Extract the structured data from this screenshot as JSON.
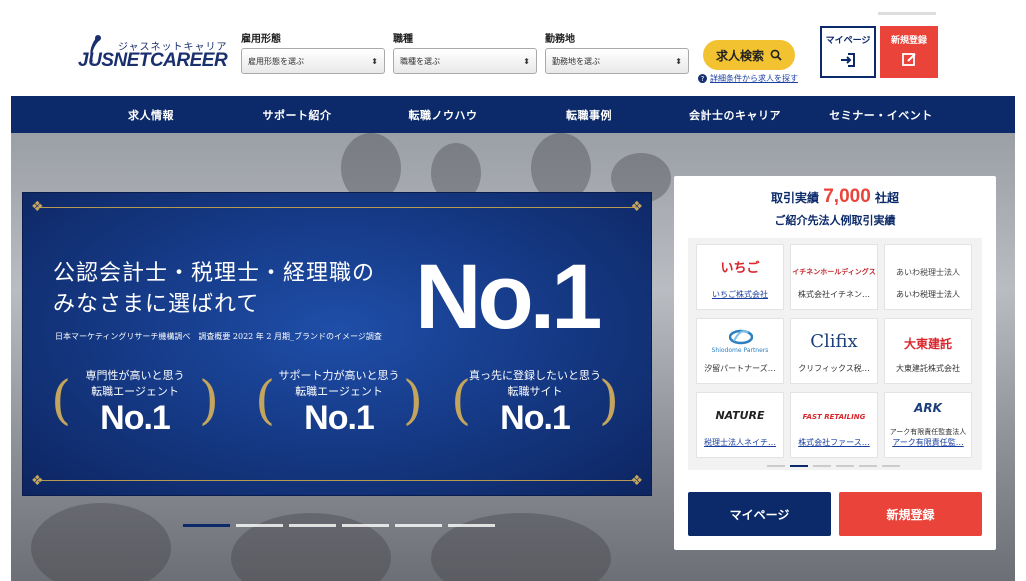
{
  "header": {
    "logo_kana": "ジャスネットキャリア",
    "logo_word": "JUSNETCAREER",
    "selects": [
      {
        "label": "雇用形態",
        "value": "雇用形態を選ぶ"
      },
      {
        "label": "職種",
        "value": "職種を選ぶ"
      },
      {
        "label": "勤務地",
        "value": "勤務地を選ぶ"
      }
    ],
    "search_label": "求人検索",
    "detail_link": "詳細条件から求人を探す",
    "mypage_label": "マイページ",
    "register_label": "新規登録"
  },
  "nav": {
    "items": [
      "求人情報",
      "サポート紹介",
      "転職ノウハウ",
      "転職事例",
      "会計士のキャリア",
      "セミナー・イベント"
    ]
  },
  "banner": {
    "headline_1": "公認会計士・税理士・経理職の",
    "headline_2": "みなさまに選ばれて",
    "big": "No.1",
    "note": "日本マーケティングリサーチ機構調べ　調査概要 2022 年 2 月期_ブランドのイメージ調査",
    "awards": [
      {
        "line1": "専門性が高いと思う",
        "line2": "転職エージェント",
        "no": "No.1"
      },
      {
        "line1": "サポート力が高いと思う",
        "line2": "転職エージェント",
        "no": "No.1"
      },
      {
        "line1": "真っ先に登録したいと思う",
        "line2": "転職サイト",
        "no": "No.1"
      }
    ]
  },
  "clients": {
    "title_prefix": "取引実績",
    "title_count": "7,000",
    "title_suffix": "社超",
    "subtitle": "ご紹介先法人例取引実績",
    "items": [
      {
        "logo": "いちご",
        "name": "いちご株式会社",
        "link": true,
        "color": "#d9262c"
      },
      {
        "logo": "イチネンホールディングス",
        "name": "株式会社イチネン…",
        "link": false,
        "color": "#c0282d"
      },
      {
        "logo": "あいわ税理士法人",
        "name": "あいわ税理士法人",
        "link": false,
        "color": "#444444"
      },
      {
        "logo": "Shiodome Partners",
        "name": "汐留パートナーズ…",
        "link": false,
        "color": "#2d7fc0"
      },
      {
        "logo": "Clifix",
        "name": "クリフィックス税…",
        "link": false,
        "color": "#1a3f7a"
      },
      {
        "logo": "大東建託",
        "name": "大東建託株式会社",
        "link": false,
        "color": "#d9262c"
      },
      {
        "logo": "NATURE",
        "name": "税理士法人ネイチ…",
        "link": true,
        "color": "#222222"
      },
      {
        "logo": "FAST RETAILING",
        "name": "株式会社ファース…",
        "link": true,
        "color": "#d9262c"
      },
      {
        "logo": "ARK",
        "name": "アーク有限責任監…",
        "link": true,
        "color": "#1a3f7a",
        "sub": "アーク有限責任監査法人"
      }
    ],
    "mypage_button": "マイページ",
    "register_button": "新規登録"
  },
  "colors": {
    "navy": "#0c2a6a",
    "red": "#e9433a",
    "yellow": "#f3c230"
  }
}
